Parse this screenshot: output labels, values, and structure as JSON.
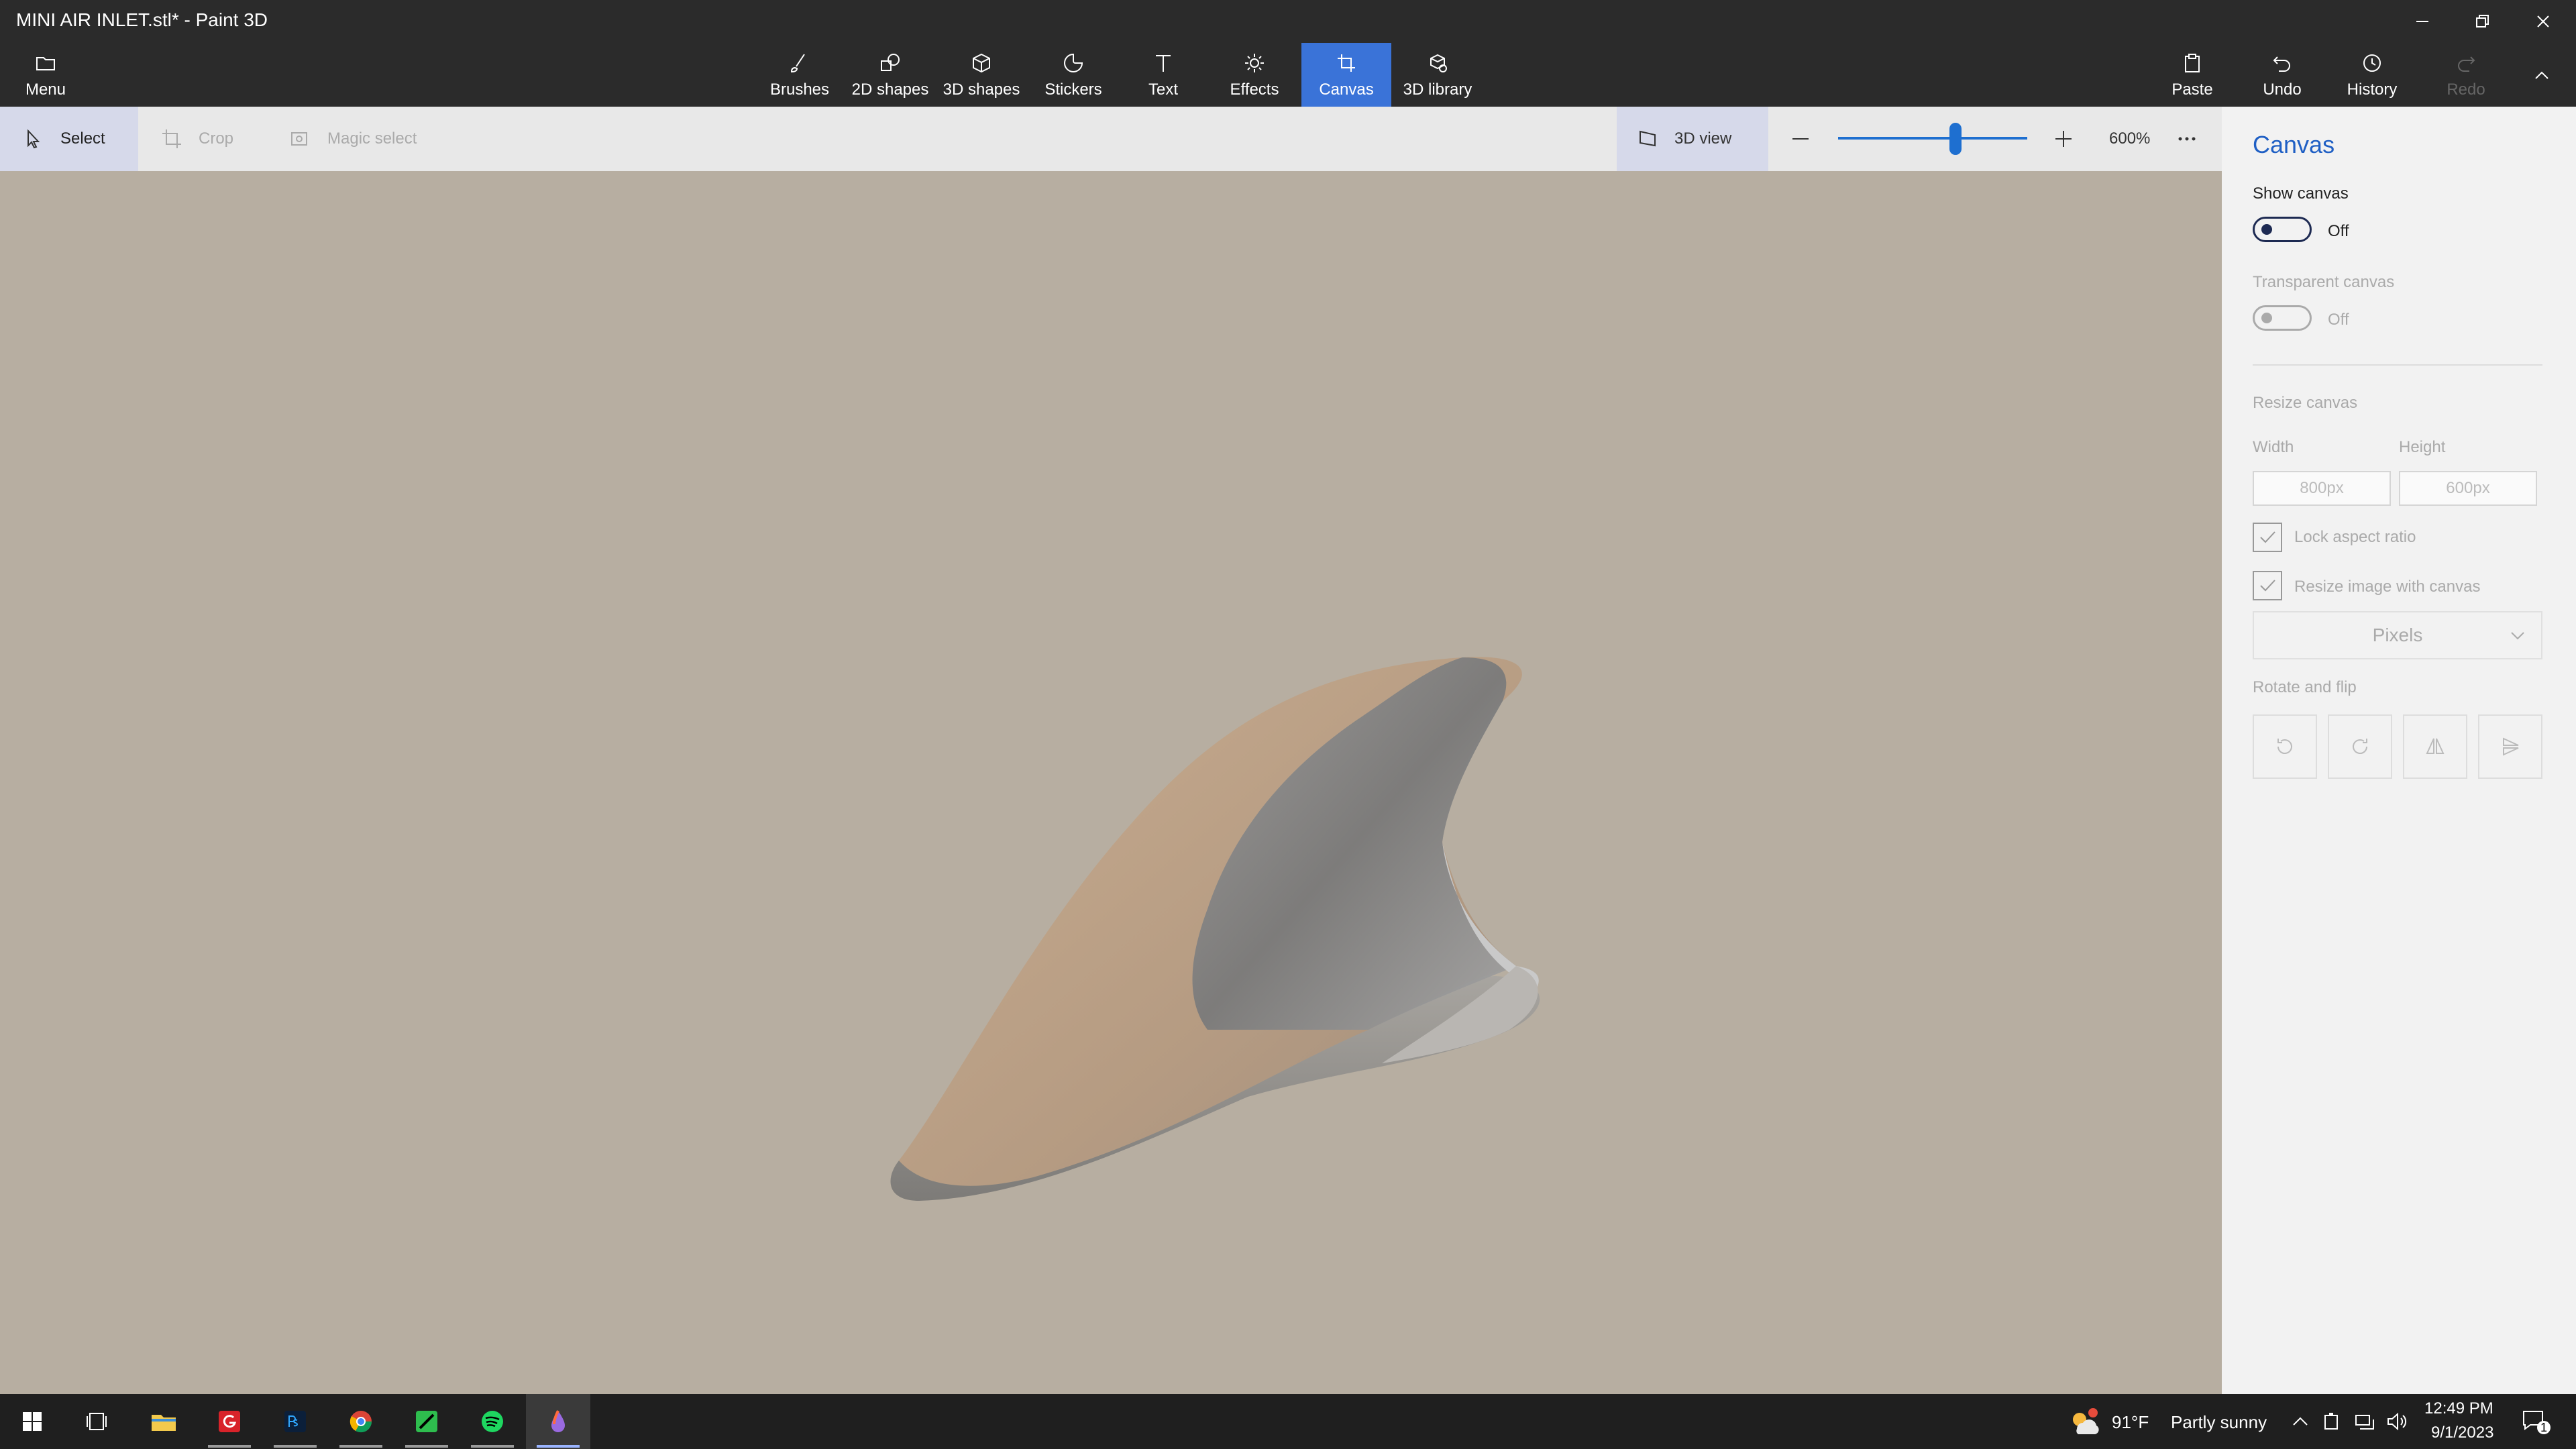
{
  "window": {
    "title": "MINI AIR INLET.stl* - Paint 3D"
  },
  "ribbon": {
    "menu_label": "Menu",
    "tools": [
      {
        "label": "Brushes",
        "icon": "brush-icon"
      },
      {
        "label": "2D shapes",
        "icon": "2d-shapes-icon"
      },
      {
        "label": "3D shapes",
        "icon": "3d-shapes-icon"
      },
      {
        "label": "Stickers",
        "icon": "sticker-icon"
      },
      {
        "label": "Text",
        "icon": "text-icon"
      },
      {
        "label": "Effects",
        "icon": "effects-icon"
      },
      {
        "label": "Canvas",
        "icon": "canvas-icon",
        "active": true
      },
      {
        "label": "3D library",
        "icon": "3d-library-icon"
      }
    ],
    "paste_label": "Paste",
    "undo_label": "Undo",
    "history_label": "History",
    "redo_label": "Redo"
  },
  "toolbar": {
    "select_label": "Select",
    "crop_label": "Crop",
    "magic_select_label": "Magic select",
    "view3d_label": "3D view",
    "zoom_percent": "600%",
    "zoom_level": 0.62
  },
  "panel": {
    "title": "Canvas",
    "show_canvas_label": "Show canvas",
    "show_canvas_state": "Off",
    "transparent_canvas_label": "Transparent canvas",
    "transparent_canvas_state": "Off",
    "resize_label": "Resize canvas",
    "width_label": "Width",
    "height_label": "Height",
    "width_value": "800px",
    "height_value": "600px",
    "lock_aspect_label": "Lock aspect ratio",
    "resize_image_label": "Resize image with canvas",
    "units_value": "Pixels",
    "rotate_flip_label": "Rotate and flip"
  },
  "taskbar": {
    "weather_temp": "91°F",
    "weather_desc": "Partly sunny",
    "time": "12:49 PM",
    "date": "9/1/2023",
    "notification_count": "1"
  },
  "colors": {
    "accent": "#3a73d8",
    "canvas_bg": "#b7aea1",
    "titlebar_bg": "#2b2b2b"
  }
}
